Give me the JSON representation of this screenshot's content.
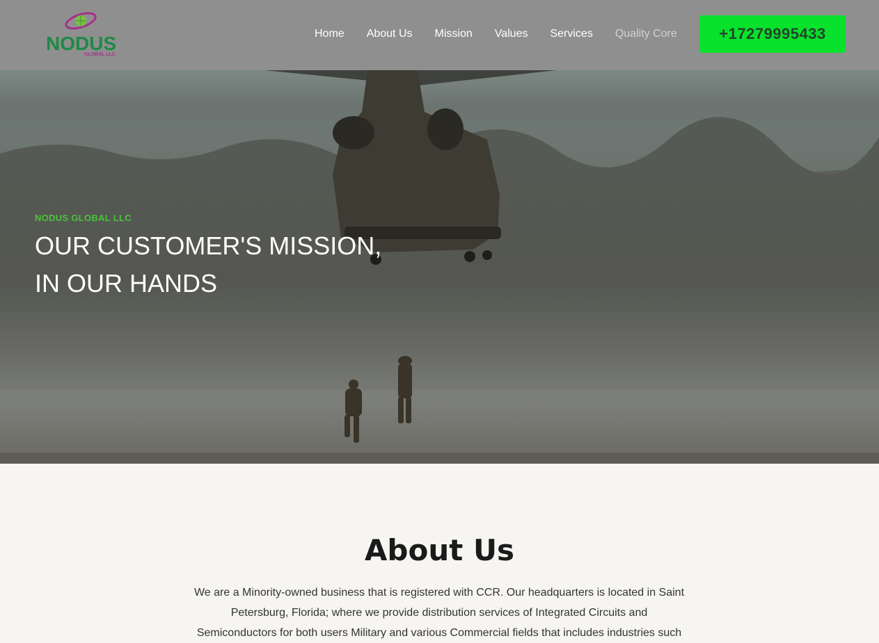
{
  "brand": {
    "logo_word": "NODUS",
    "logo_sub": "GLOBAL LLC",
    "colors": {
      "green": "#1e8a46",
      "magenta": "#a4308a",
      "phone_bg": "#08e22c",
      "kicker": "#4bc13c"
    }
  },
  "nav": {
    "items": [
      {
        "label": "Home"
      },
      {
        "label": "About Us"
      },
      {
        "label": "Mission"
      },
      {
        "label": "Values"
      },
      {
        "label": "Services"
      },
      {
        "label": "Quality Core"
      }
    ],
    "phone": "+17279995433"
  },
  "hero": {
    "kicker": "NODUS GLOBAL LLC",
    "title_line1": "OUR CUSTOMER'S MISSION,",
    "title_line2": "IN OUR HANDS"
  },
  "about": {
    "title": "About Us",
    "text": "We are a Minority-owned business that is registered with CCR. Our headquarters is located in Saint Petersburg, Florida; where we provide distribution services of Integrated Circuits and Semiconductors for both users Military and various Commercial fields that includes industries such"
  }
}
